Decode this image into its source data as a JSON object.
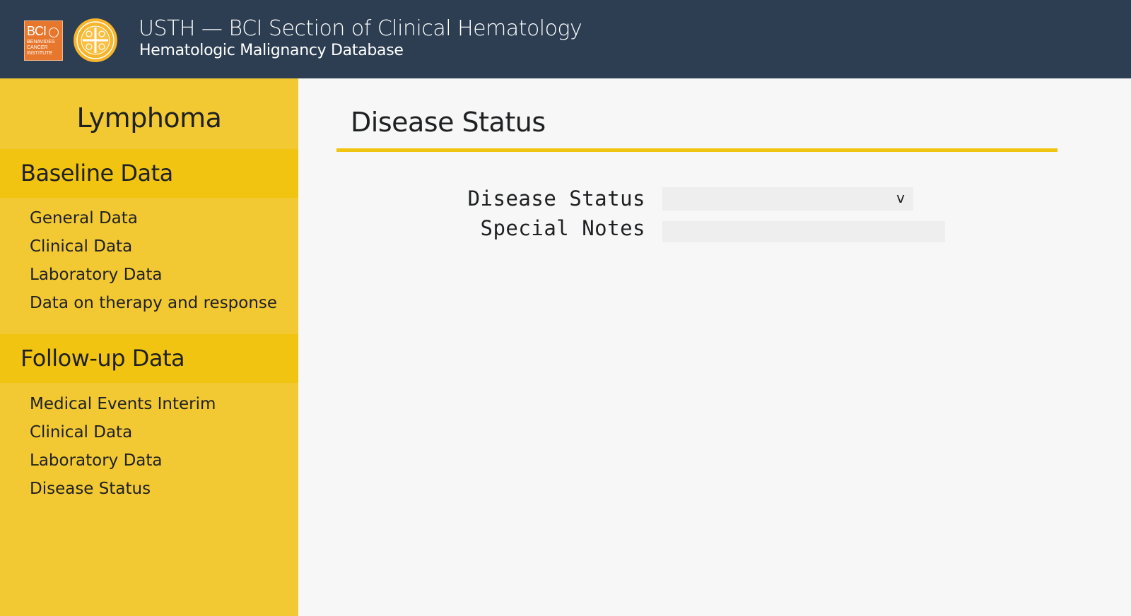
{
  "header": {
    "logo_bci": {
      "icon": "bci-logo",
      "text": "BCI",
      "subtext": "BENAVIDES CANCER INSTITUTE"
    },
    "logo_seal": {
      "icon": "ust-seal-logo"
    },
    "title": "USTH — BCI Section of Clinical Hematology",
    "subtitle": "Hematologic Malignancy Database"
  },
  "sidebar": {
    "title": "Lymphoma",
    "sections": [
      {
        "label": "Baseline Data",
        "items": [
          {
            "label": "General Data"
          },
          {
            "label": "Clinical Data"
          },
          {
            "label": "Laboratory Data"
          },
          {
            "label": "Data on therapy and response"
          }
        ]
      },
      {
        "label": "Follow-up Data",
        "items": [
          {
            "label": "Medical Events Interim"
          },
          {
            "label": "Clinical Data"
          },
          {
            "label": "Laboratory Data"
          },
          {
            "label": "Disease Status"
          }
        ]
      }
    ]
  },
  "main": {
    "title": "Disease Status",
    "form": {
      "disease_status_label": "Disease Status",
      "disease_status_value": "",
      "disease_status_caret": "v",
      "special_notes_label": "Special Notes",
      "special_notes_value": "",
      "special_notes_placeholder": ""
    }
  },
  "colors": {
    "header_bg": "#2d3e52",
    "sidebar_bg": "#f2c933",
    "section_header_bg": "#f1c411",
    "accent_rule": "#f1c411",
    "content_bg": "#f7f7f7",
    "logo_orange": "#e8772e",
    "seal_yellow": "#f7b52c"
  }
}
